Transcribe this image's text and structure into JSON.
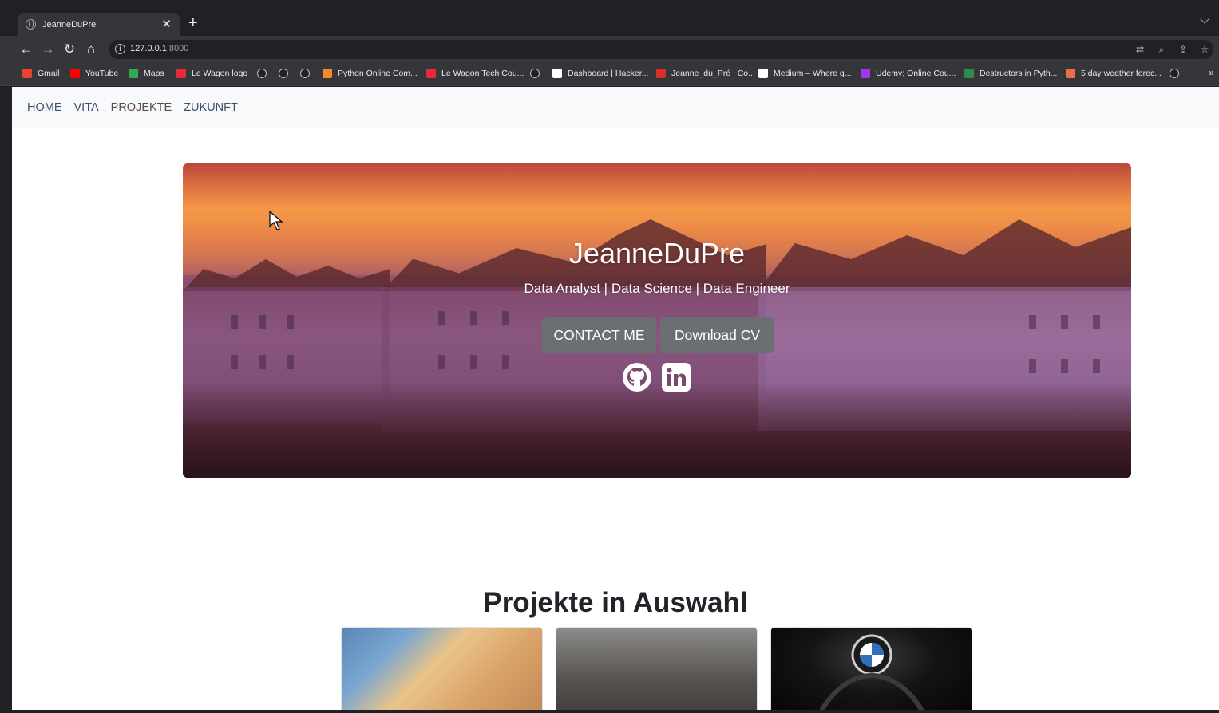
{
  "browser": {
    "tab_title": "JeanneDuPre",
    "url_host": "127.0.0.1",
    "url_port": ":8000",
    "bookmarks": [
      {
        "label": "Gmail",
        "color": "#ea4335"
      },
      {
        "label": "YouTube",
        "color": "#ff0000"
      },
      {
        "label": "Maps",
        "color": "#34a853"
      },
      {
        "label": "Le Wagon logo",
        "color": "#e52b3b"
      },
      {
        "label": "",
        "color": "globe"
      },
      {
        "label": "",
        "color": "globe"
      },
      {
        "label": "",
        "color": "globe"
      },
      {
        "label": "Python Online Com...",
        "color": "#f28b25"
      },
      {
        "label": "Le Wagon Tech Cou...",
        "color": "#e52b3b"
      },
      {
        "label": "",
        "color": "globe"
      },
      {
        "label": "Dashboard | Hacker...",
        "color": "#ffffff"
      },
      {
        "label": "Jeanne_du_Pré | Co...",
        "color": "#d93025"
      },
      {
        "label": "Medium – Where g...",
        "color": "#ffffff"
      },
      {
        "label": "Udemy: Online Cou...",
        "color": "#a435f0"
      },
      {
        "label": "Destructors in Pyth...",
        "color": "#2f8d46"
      },
      {
        "label": "5 day weather forec...",
        "color": "#eb6e4b"
      },
      {
        "label": "",
        "color": "globe"
      }
    ]
  },
  "site": {
    "nav": [
      "HOME",
      "VITA",
      "PROJEKTE",
      "ZUKUNFT"
    ],
    "hero": {
      "title": "JeanneDuPre",
      "subtitle": "Data Analyst | Data Science | Data Engineer",
      "contact_label": "CONTACT ME",
      "download_label": "Download CV"
    },
    "projects_title": "Projekte in Auswahl"
  }
}
